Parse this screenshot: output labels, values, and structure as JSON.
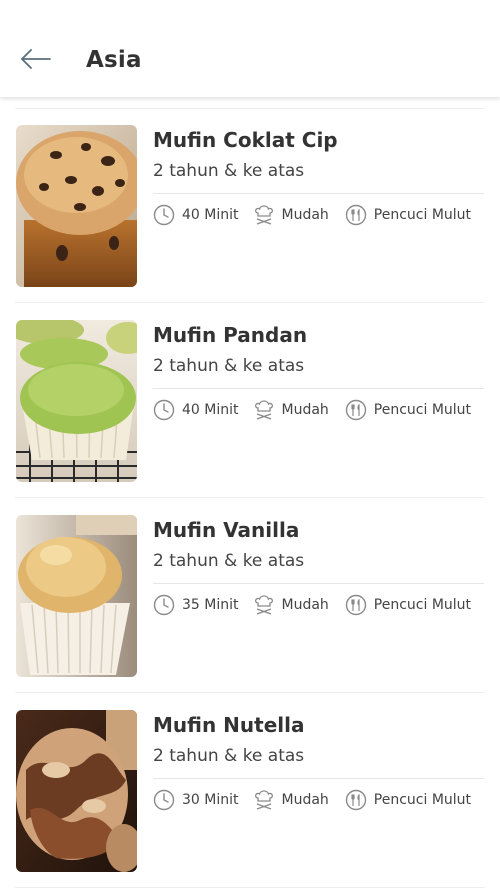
{
  "header": {
    "title": "Asia",
    "back_icon": "arrow-left-icon"
  },
  "items": [
    {
      "title": "Mufin Coklat Cip",
      "age": "2 tahun & ke atas",
      "time": "40 Minit",
      "difficulty": "Mudah",
      "category": "Pencuci Mulut",
      "image": "chocolate-chip-muffin-photo"
    },
    {
      "title": "Mufin Pandan",
      "age": "2 tahun & ke atas",
      "time": "40 Minit",
      "difficulty": "Mudah",
      "category": "Pencuci Mulut",
      "image": "pandan-muffin-photo"
    },
    {
      "title": "Mufin Vanilla",
      "age": "2 tahun & ke atas",
      "time": "35 Minit",
      "difficulty": "Mudah",
      "category": "Pencuci Mulut",
      "image": "vanilla-muffin-photo"
    },
    {
      "title": "Mufin Nutella",
      "age": "2 tahun & ke atas",
      "time": "30 Minit",
      "difficulty": "Mudah",
      "category": "Pencuci Mulut",
      "image": "nutella-muffin-photo"
    }
  ],
  "icons": {
    "time": "clock-icon",
    "difficulty": "chef-hat-icon",
    "category": "fork-knife-icon"
  },
  "colors": {
    "text": "#333333",
    "icon_gray": "#8a8a8a",
    "divider": "#eeeeee"
  }
}
